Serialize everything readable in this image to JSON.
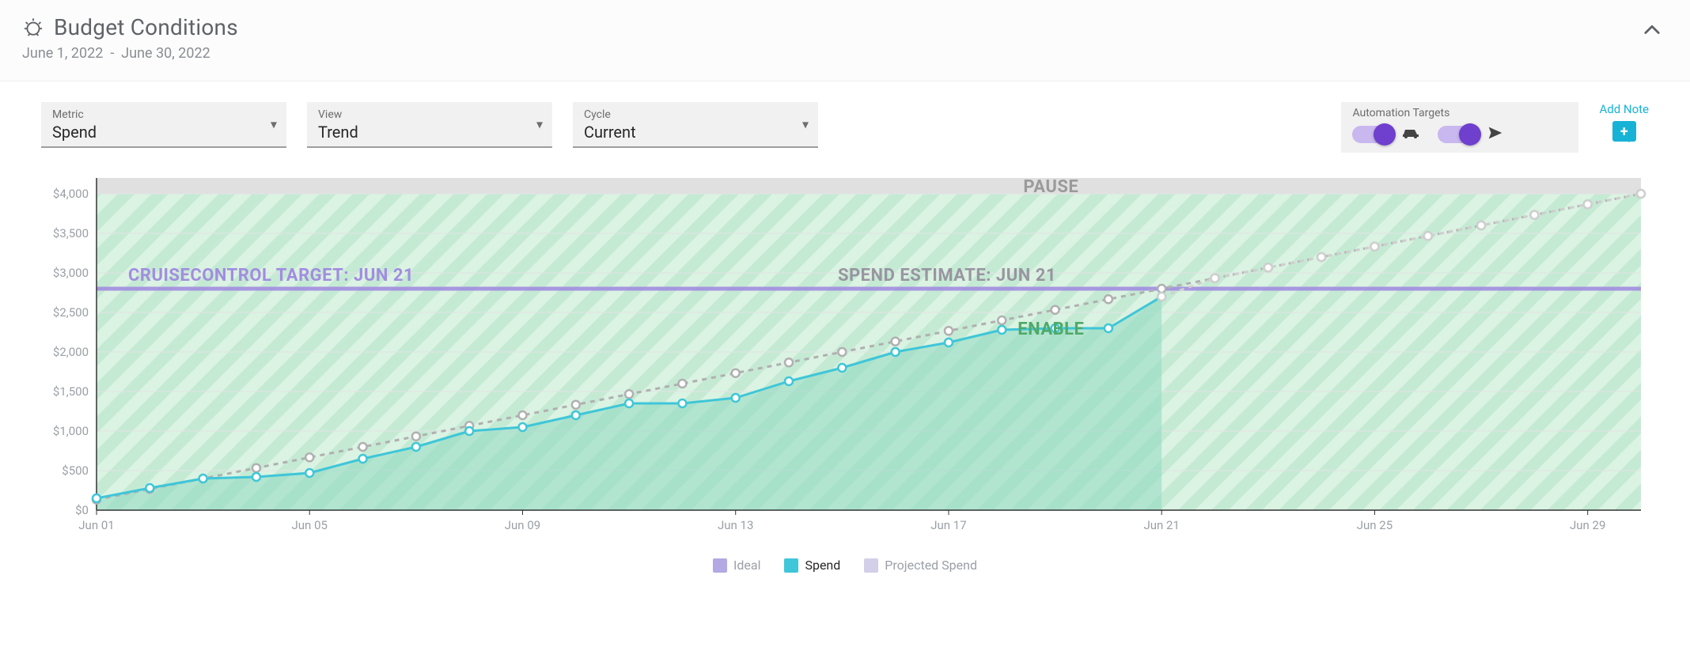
{
  "header": {
    "title": "Budget Conditions",
    "date_from": "June 1, 2022",
    "date_sep": "-",
    "date_to": "June 30, 2022"
  },
  "selects": {
    "metric": {
      "label": "Metric",
      "value": "Spend"
    },
    "view": {
      "label": "View",
      "value": "Trend"
    },
    "cycle": {
      "label": "Cycle",
      "value": "Current"
    }
  },
  "automation": {
    "label": "Automation Targets",
    "toggles": [
      {
        "name": "car-toggle",
        "on": true,
        "icon": "car"
      },
      {
        "name": "plane-toggle",
        "on": true,
        "icon": "plane"
      }
    ]
  },
  "addNote": {
    "link": "Add Note"
  },
  "legend": {
    "ideal": "Ideal",
    "spend": "Spend",
    "projected": "Projected Spend"
  },
  "colors": {
    "ideal": "#9c8fd6",
    "spend": "#3fc6d8",
    "spend_fill": "#8fd9c1",
    "projected_fill": "#cfcfcf",
    "enable_stripe_a": "#95d8b0",
    "enable_stripe_b": "#bce9ca",
    "pause": "#d6d6d6",
    "target_line": "#a18de0",
    "axis": "#9aa0a6",
    "grid": "#e3e3e3"
  },
  "annotations": {
    "cruise_control": "CRUISECONTROL TARGET: JUN 21",
    "spend_estimate": "SPEND ESTIMATE: JUN 21",
    "pause": "PAUSE",
    "enable": "ENABLE",
    "target_value": 2800,
    "pause_threshold": 4000
  },
  "chart_data": {
    "type": "line",
    "title": "Budget Conditions — Spend Trend (Current Cycle)",
    "xlabel": "",
    "ylabel": "",
    "ylim": [
      0,
      4200
    ],
    "y_ticks": [
      0,
      500,
      1000,
      1500,
      2000,
      2500,
      3000,
      3500,
      4000
    ],
    "categories": [
      "Jun 01",
      "Jun 02",
      "Jun 03",
      "Jun 04",
      "Jun 05",
      "Jun 06",
      "Jun 07",
      "Jun 08",
      "Jun 09",
      "Jun 10",
      "Jun 11",
      "Jun 12",
      "Jun 13",
      "Jun 14",
      "Jun 15",
      "Jun 16",
      "Jun 17",
      "Jun 18",
      "Jun 19",
      "Jun 20",
      "Jun 21",
      "Jun 22",
      "Jun 23",
      "Jun 24",
      "Jun 25",
      "Jun 26",
      "Jun 27",
      "Jun 28",
      "Jun 29",
      "Jun 30"
    ],
    "x_tick_labels": [
      "Jun 01",
      "Jun 05",
      "Jun 09",
      "Jun 13",
      "Jun 17",
      "Jun 21",
      "Jun 25",
      "Jun 29"
    ],
    "x_tick_indices": [
      0,
      4,
      8,
      12,
      16,
      20,
      24,
      28
    ],
    "series": [
      {
        "name": "Ideal",
        "style": "dashed",
        "color": "#b0b0b0",
        "values": [
          133,
          267,
          400,
          533,
          667,
          800,
          933,
          1067,
          1200,
          1333,
          1467,
          1600,
          1733,
          1867,
          2000,
          2133,
          2267,
          2400,
          2533,
          2667,
          2800,
          2933,
          3067,
          3200,
          3333,
          3467,
          3600,
          3733,
          3867,
          4000
        ]
      },
      {
        "name": "Spend",
        "style": "solid",
        "color": "#3fc6d8",
        "values": [
          150,
          280,
          400,
          420,
          470,
          650,
          800,
          1000,
          1050,
          1200,
          1350,
          1350,
          1420,
          1630,
          1800,
          2000,
          2120,
          2280,
          2300,
          2300,
          2700,
          null,
          null,
          null,
          null,
          null,
          null,
          null,
          null,
          null
        ]
      },
      {
        "name": "Projected Spend",
        "style": "dashed",
        "color": "#cfcfcf",
        "values": [
          null,
          null,
          null,
          null,
          null,
          null,
          null,
          null,
          null,
          null,
          null,
          null,
          null,
          null,
          null,
          null,
          null,
          null,
          null,
          null,
          2700,
          2933,
          3067,
          3200,
          3333,
          3467,
          3600,
          3733,
          3867,
          4000
        ]
      }
    ]
  }
}
